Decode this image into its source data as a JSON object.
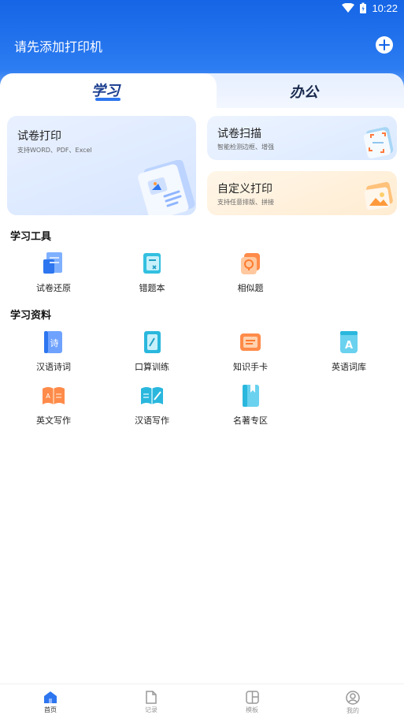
{
  "status_bar": {
    "time": "10:22"
  },
  "header": {
    "title": "请先添加打印机"
  },
  "tabs": [
    {
      "label": "学习",
      "active": true
    },
    {
      "label": "办公",
      "active": false
    }
  ],
  "cards": {
    "paper_print": {
      "title": "试卷打印",
      "subtitle": "支持WORD、PDF、Excel"
    },
    "paper_scan": {
      "title": "试卷扫描",
      "subtitle": "智能检测边框、增强"
    },
    "custom_print": {
      "title": "自定义打印",
      "subtitle": "支持任意排版、拼接"
    }
  },
  "study_tools": {
    "title": "学习工具",
    "items": [
      {
        "label": "试卷还原",
        "icon": "paper-restore-icon"
      },
      {
        "label": "错题本",
        "icon": "wrong-questions-icon"
      },
      {
        "label": "相似题",
        "icon": "similar-questions-icon"
      }
    ]
  },
  "study_materials": {
    "title": "学习资料",
    "items": [
      {
        "label": "汉语诗词",
        "icon": "chinese-poetry-icon"
      },
      {
        "label": "口算训练",
        "icon": "mental-math-icon"
      },
      {
        "label": "知识手卡",
        "icon": "knowledge-card-icon"
      },
      {
        "label": "英语词库",
        "icon": "english-vocab-icon"
      },
      {
        "label": "英文写作",
        "icon": "english-writing-icon"
      },
      {
        "label": "汉语写作",
        "icon": "chinese-writing-icon"
      },
      {
        "label": "名著专区",
        "icon": "classics-icon"
      }
    ]
  },
  "bottom_nav": [
    {
      "label": "首页",
      "icon": "home-icon",
      "active": true
    },
    {
      "label": "记录",
      "icon": "record-icon",
      "active": false
    },
    {
      "label": "模板",
      "icon": "template-icon",
      "active": false
    },
    {
      "label": "我的",
      "icon": "profile-icon",
      "active": false
    }
  ],
  "colors": {
    "primary": "#1565e6",
    "tab_underline": "#2d76ef",
    "card_blue": "#dbe9ff",
    "card_orange": "#ffecd2"
  }
}
